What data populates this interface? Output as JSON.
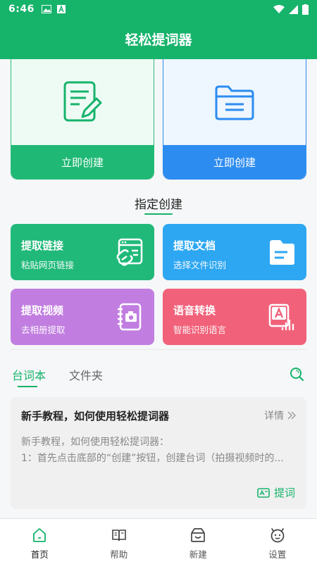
{
  "status_bar": {
    "time": "6:46"
  },
  "app_bar": {
    "title": "轻松提词器"
  },
  "quick_create": [
    {
      "label": "立即创建",
      "icon": "edit-document-icon"
    },
    {
      "label": "立即创建",
      "icon": "folder-icon"
    }
  ],
  "section": {
    "title": "指定创建"
  },
  "tiles": {
    "link": {
      "title": "提取链接",
      "subtitle": "粘贴网页链接",
      "icon": "link-icon"
    },
    "doc": {
      "title": "提取文档",
      "subtitle": "选择文件识别",
      "icon": "document-icon"
    },
    "video": {
      "title": "提取视频",
      "subtitle": "去相册提取",
      "icon": "album-icon"
    },
    "voice": {
      "title": "语音转换",
      "subtitle": "智能识别语言",
      "icon": "voice-to-text-icon"
    }
  },
  "tabs": [
    {
      "label": "台词本",
      "active": true
    },
    {
      "label": "文件夹",
      "active": false
    }
  ],
  "tutorial": {
    "title": "新手教程，如何使用轻松提词器",
    "detail": "详情",
    "line1": "新手教程，如何使用轻松提词器：",
    "line2": "1：首先点击底部的“创建”按钮，创建台词（拍摄视频时的...",
    "action": "提词"
  },
  "nav": [
    {
      "label": "首页",
      "icon": "home-icon",
      "active": true
    },
    {
      "label": "帮助",
      "icon": "book-icon",
      "active": false
    },
    {
      "label": "新建",
      "icon": "add-box-icon",
      "active": false
    },
    {
      "label": "设置",
      "icon": "settings-face-icon",
      "active": false
    }
  ],
  "colors": {
    "primary": "#16b36b",
    "blue": "#2d8cf0",
    "doc_tile": "#2ea7f2",
    "video_tile": "#c17ee0",
    "voice_tile": "#f1627a"
  }
}
